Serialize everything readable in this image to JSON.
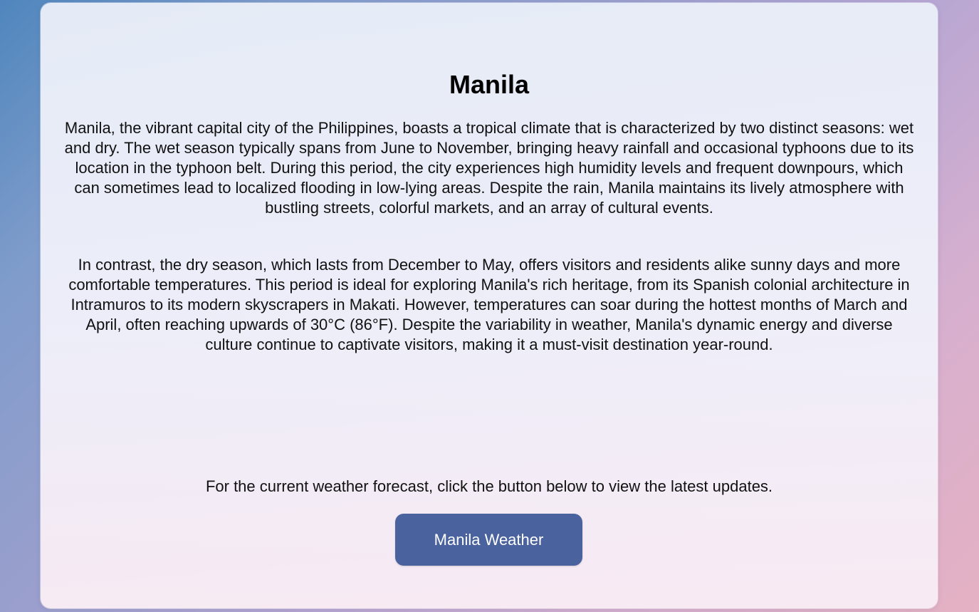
{
  "page": {
    "title": "Manila",
    "paragraphs": [
      "Manila, the vibrant capital city of the Philippines, boasts a tropical climate that is characterized by two distinct seasons: wet and dry. The wet season typically spans from June to November, bringing heavy rainfall and occasional typhoons due to its location in the typhoon belt. During this period, the city experiences high humidity levels and frequent downpours, which can sometimes lead to localized flooding in low-lying areas. Despite the rain, Manila maintains its lively atmosphere with bustling streets, colorful markets, and an array of cultural events.",
      "In contrast, the dry season, which lasts from December to May, offers visitors and residents alike sunny days and more comfortable temperatures. This period is ideal for exploring Manila's rich heritage, from its Spanish colonial architecture in Intramuros to its modern skyscrapers in Makati. However, temperatures can soar during the hottest months of March and April, often reaching upwards of 30°C (86°F). Despite the variability in weather, Manila's dynamic energy and diverse culture continue to captivate visitors, making it a must-visit destination year-round."
    ],
    "cta_text": "For the current weather forecast, click the button below to view the latest updates.",
    "button_label": "Manila Weather"
  },
  "colors": {
    "button_background": "#4a639f",
    "button_text": "#ffffff",
    "text": "#111111",
    "gradient_start": "#4f86bd",
    "gradient_end": "#e5b1c3"
  }
}
